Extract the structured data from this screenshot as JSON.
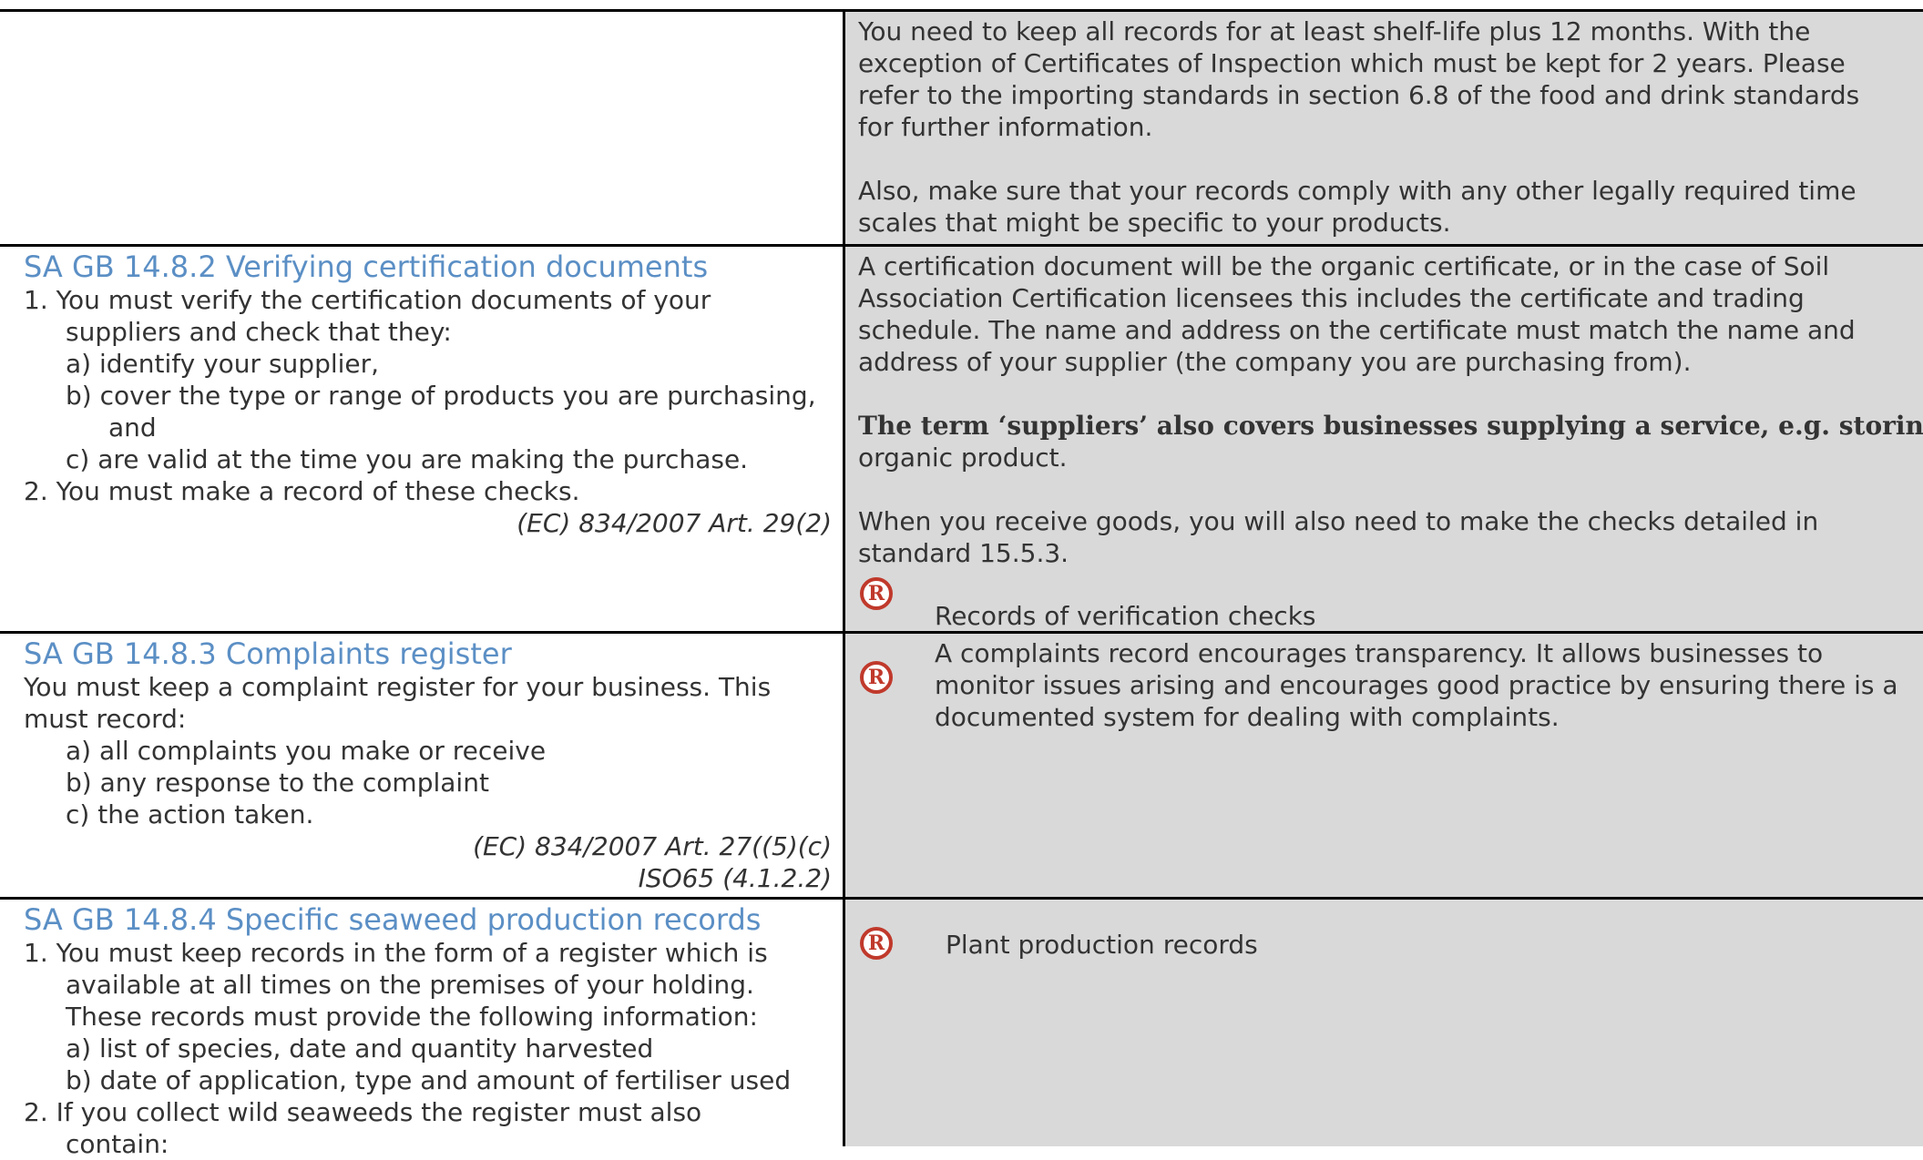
{
  "row1": {
    "right_lines": [
      "You need to keep all records for at least shelf-life plus 12 months. With the",
      "exception of Certificates of Inspection which must be kept for 2 years.  Please",
      "refer to the importing standards in section 6.8 of the food and drink standards",
      "for further information.",
      "Also, make sure that your records comply with any other legally required time",
      "scales that might be specific to your products."
    ]
  },
  "row2": {
    "heading": "SA GB 14.8.2 Verifying certification documents",
    "left_lines": [
      "1.   You must verify the certification documents of your",
      "suppliers and check that they:",
      "a)   identify your supplier,",
      "b)   cover the type or range of products you are purchasing,",
      "and",
      "c)   are valid at the time you are making the purchase.",
      "2.   You must make a record of these checks."
    ],
    "reference": "(EC) 834/2007 Art. 29(2)",
    "right_lines": [
      "A certification document will be the organic certificate, or in the case of Soil",
      "Association Certification licensees this includes the certificate and trading",
      "schedule. The name and address on the certificate must match the name and",
      "address of your supplier (the company you are purchasing from)."
    ],
    "bold_line": "The term ‘suppliers’ also covers businesses supplying a service, e.g. storing",
    "bold_after": "organic product.",
    "receive_lines": [
      "When you receive goods, you will also need to make the checks detailed in",
      "standard 15.5.3."
    ],
    "record_label": "Records of verification checks"
  },
  "row3": {
    "heading": "SA GB 14.8.3 Complaints register",
    "left_lines": [
      "You must keep a complaint register for your business. This",
      "must record:",
      "a)   all complaints you make or receive",
      "b)   any response to the complaint",
      "c)   the action taken."
    ],
    "reference_1": "(EC) 834/2007 Art. 27((5)(c)",
    "reference_2": "ISO65 (4.1.2.2)",
    "right_lines": [
      "A complaints record encourages transparency. It allows businesses to",
      "monitor issues arising and encourages good practice by ensuring there is a",
      "documented system for dealing with complaints."
    ]
  },
  "row4": {
    "heading": "SA GB 14.8.4 Specific seaweed production records",
    "left_lines": [
      "1.   You must keep records in the form of a register which is",
      "available at all times on the premises of your holding.",
      "These records must provide the following information:",
      "a)   list of species, date and quantity harvested",
      "b)   date of application, type and amount of fertiliser used",
      "2.   If you collect wild seaweeds the register must also",
      "contain:"
    ],
    "record_label": "Plant production records"
  },
  "icons": {
    "record": "R"
  },
  "colors": {
    "heading": "#5b8fc5",
    "icon": "#c0392b",
    "guidance_bg": "#d9d9d9"
  }
}
